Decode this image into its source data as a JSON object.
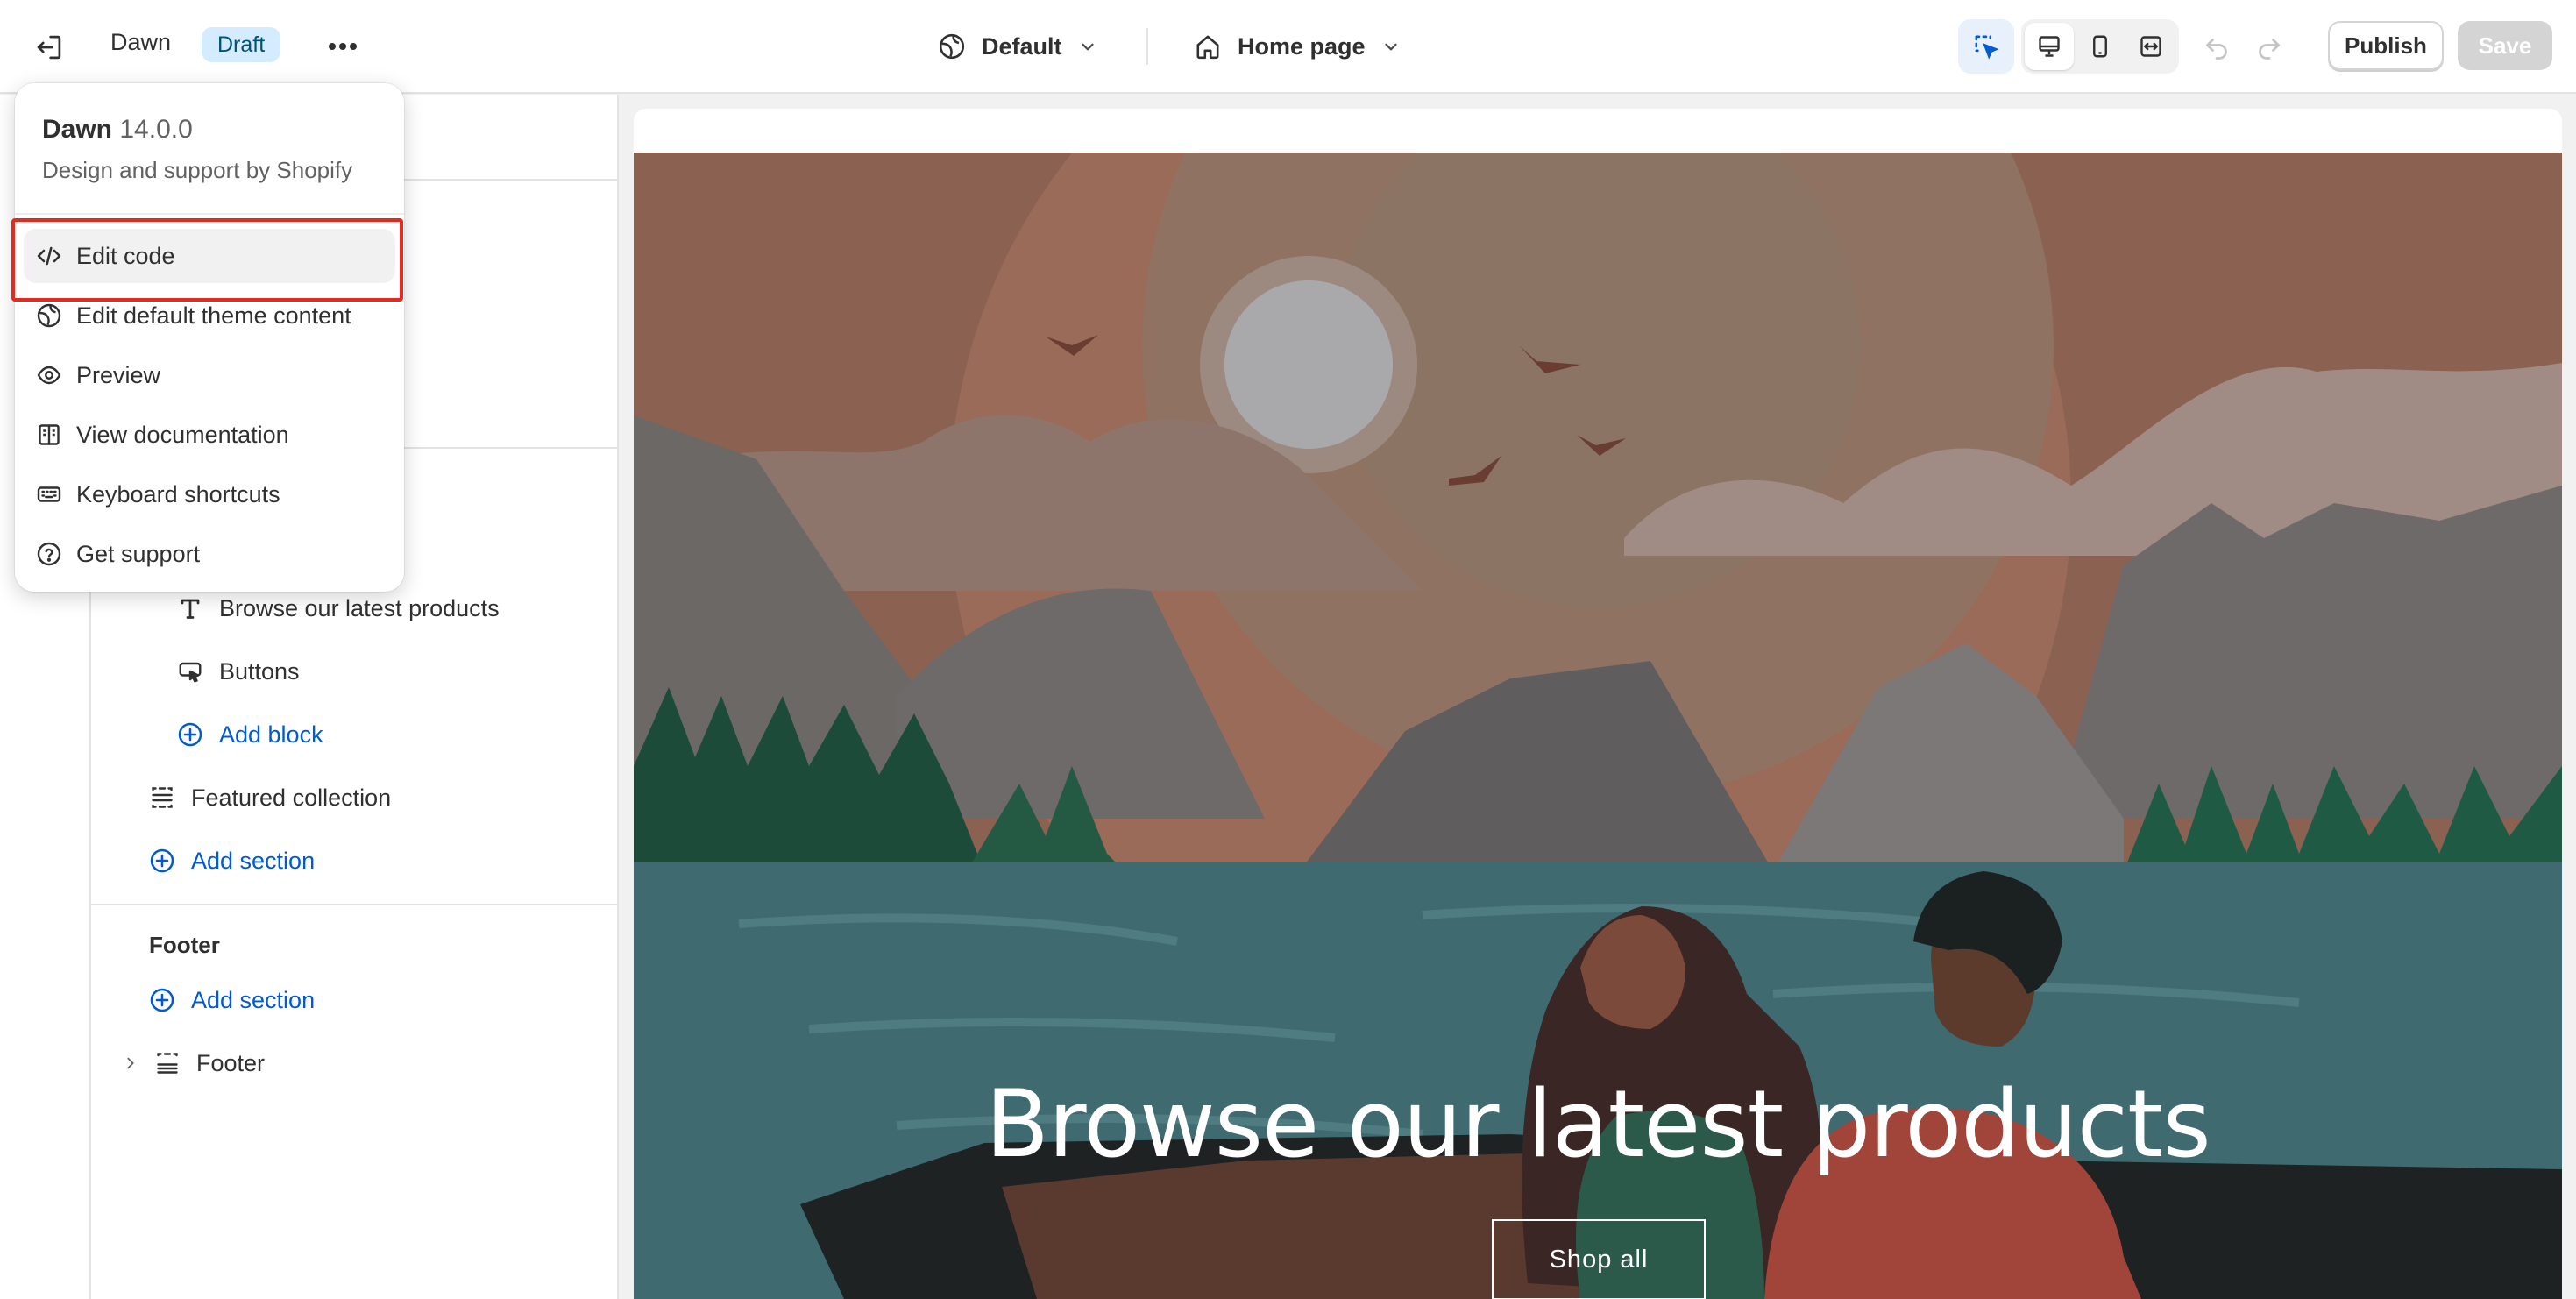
{
  "topbar": {
    "theme_name": "Dawn",
    "status_badge": "Draft",
    "theme_selector": "Default",
    "page_selector": "Home page",
    "publish_label": "Publish",
    "save_label": "Save"
  },
  "menu": {
    "theme_name": "Dawn",
    "theme_version": "14.0.0",
    "subtitle": "Design and support by Shopify",
    "items": [
      {
        "label": "Edit code",
        "icon": "code-icon"
      },
      {
        "label": "Edit default theme content",
        "icon": "globe-icon"
      },
      {
        "label": "Preview",
        "icon": "eye-icon"
      },
      {
        "label": "View documentation",
        "icon": "book-icon"
      },
      {
        "label": "Keyboard shortcuts",
        "icon": "keyboard-icon"
      },
      {
        "label": "Get support",
        "icon": "question-circle-icon"
      }
    ]
  },
  "sections_panel": {
    "blocks": [
      {
        "label": "Browse our latest products",
        "icon": "text-icon"
      },
      {
        "label": "Buttons",
        "icon": "button-icon"
      }
    ],
    "add_block_label": "Add block",
    "featured_collection_label": "Featured collection",
    "add_section_label": "Add section",
    "footer_group_title": "Footer",
    "footer_add_section_label": "Add section",
    "footer_label": "Footer"
  },
  "preview": {
    "hero_heading": "Browse our latest products",
    "hero_button": "Shop all"
  },
  "colors": {
    "accent": "#005bd3",
    "highlight": "#e22a1e",
    "badge_bg": "#d5ebff"
  }
}
